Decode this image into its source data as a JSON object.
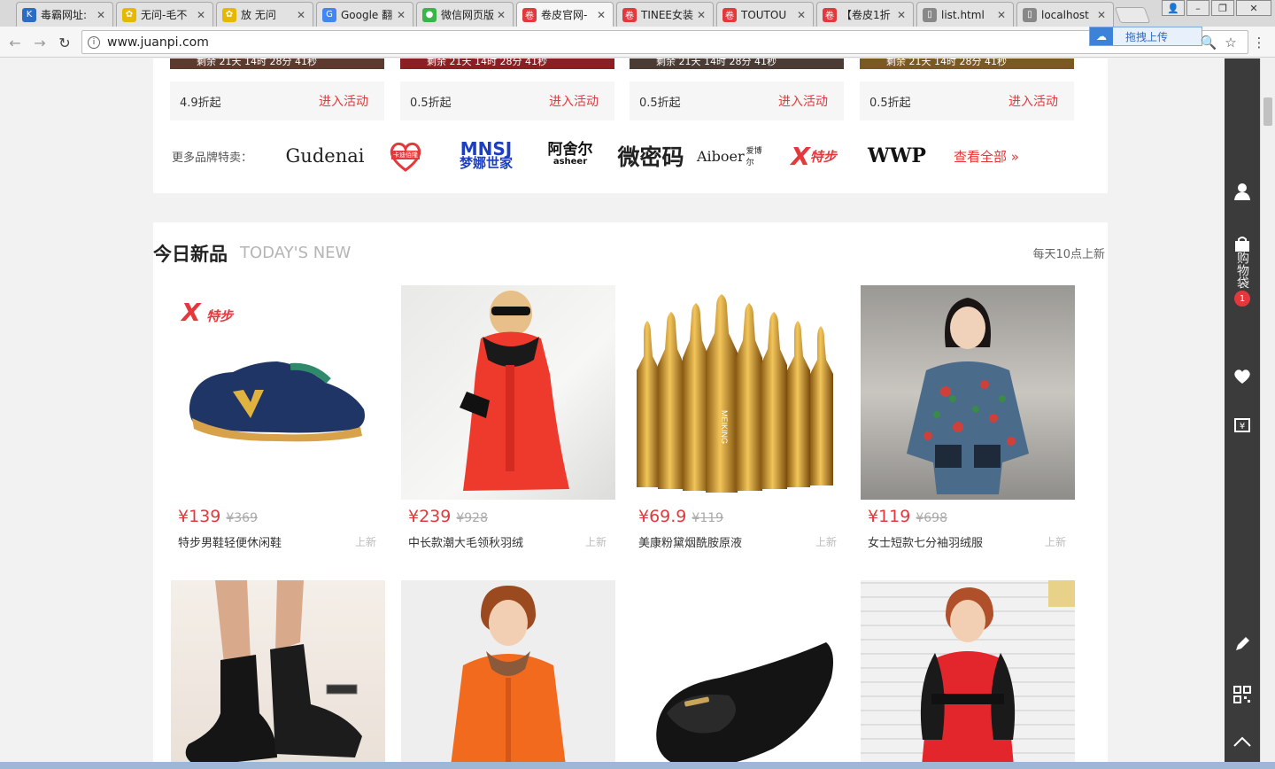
{
  "browser": {
    "tabs": [
      {
        "title": "毒霸网址:",
        "favicon": "K",
        "color": "#2d6cc0"
      },
      {
        "title": "无问-毛不",
        "favicon": "✿",
        "color": "#e6b800"
      },
      {
        "title": "放 无问",
        "favicon": "✿",
        "color": "#e6b800"
      },
      {
        "title": "Google 翻",
        "favicon": "G",
        "color": "#4285f4"
      },
      {
        "title": "微信网页版",
        "favicon": "●",
        "color": "#39b54a"
      },
      {
        "title": "卷皮官网-",
        "favicon": "卷",
        "color": "#e4393c"
      },
      {
        "title": "TINEE女装",
        "favicon": "卷",
        "color": "#e4393c"
      },
      {
        "title": "TOUTOU",
        "favicon": "卷",
        "color": "#e4393c"
      },
      {
        "title": "【卷皮1折",
        "favicon": "卷",
        "color": "#e4393c"
      },
      {
        "title": "list.html",
        "favicon": "▯",
        "color": "#888888"
      },
      {
        "title": "localhost",
        "favicon": "▯",
        "color": "#888888"
      }
    ],
    "url": "www.juanpi.com",
    "upload_label": "拖拽上传"
  },
  "promos": [
    {
      "strip": "剩余 21天 14时 28分 41秒",
      "discount": "4.9折起",
      "action": "进入活动"
    },
    {
      "strip": "剩余 21天 14时 28分 41秒",
      "discount": "0.5折起",
      "action": "进入活动"
    },
    {
      "strip": "剩余 21天 14时 28分 41秒",
      "discount": "0.5折起",
      "action": "进入活动"
    },
    {
      "strip": "剩余 21天 14时 28分 41秒",
      "discount": "0.5折起",
      "action": "进入活动"
    }
  ],
  "brands": {
    "label": "更多品牌特卖：",
    "items": [
      "Gudenai",
      "卡迪佰隆",
      "MNSJ",
      "梦娜世家",
      "阿舍尔",
      "asheer",
      "微密码",
      "Aiboer",
      "爱博尔",
      "特步",
      "WWP"
    ],
    "view_all": "查看全部 »"
  },
  "today_new": {
    "title": "今日新品",
    "subtitle": "TODAY'S NEW",
    "note": "每天10点上新",
    "products": [
      {
        "price": "¥139",
        "orig": "¥369",
        "name": "特步男鞋轻便休闲鞋",
        "tag": "上新",
        "brand": "特步"
      },
      {
        "price": "¥239",
        "orig": "¥928",
        "name": "中长款潮大毛领秋羽绒",
        "tag": "上新"
      },
      {
        "price": "¥69.9",
        "orig": "¥119",
        "name": "美康粉黛烟酰胺原液",
        "tag": "上新",
        "bottle_text": "MEIKING"
      },
      {
        "price": "¥119",
        "orig": "¥698",
        "name": "女士短款七分袖羽绒服",
        "tag": "上新"
      }
    ]
  },
  "sidebar": {
    "cart": "购物袋",
    "cart_count": "1"
  }
}
